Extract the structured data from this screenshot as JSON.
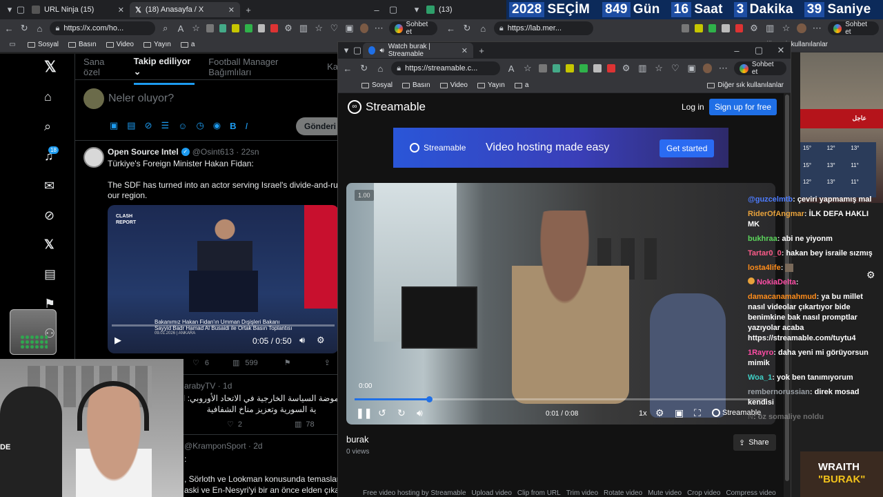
{
  "left_browser": {
    "tabs": [
      {
        "label": "URL Ninja (15)",
        "active": false
      },
      {
        "label": "(18) Anasayfa / X",
        "active": true
      }
    ],
    "url": "https://x.com/ho...",
    "copilot_label": "Sohbet et",
    "bookmarks": [
      "Sosyal",
      "Basın",
      "Video",
      "Yayın",
      "a"
    ]
  },
  "right_browser": {
    "tab_partial": "(13)",
    "url": "https://lab.mer...",
    "copilot_label": "Sohbet et",
    "other_bookmarks": "Diğer sık kullanılanlar"
  },
  "countdown": {
    "year": "2028",
    "label": "SEÇİM",
    "days": "849",
    "days_unit": "Gün",
    "hours": "16",
    "hours_unit": "Saat",
    "minutes": "3",
    "minutes_unit": "Dakika",
    "seconds": "39",
    "seconds_unit": "Saniye"
  },
  "twitter": {
    "tabs": [
      "Sana özel",
      "Takip ediliyor",
      "Football Manager Bağımlıları",
      "Ka"
    ],
    "active_tab": "Takip ediliyor",
    "notif_count": "18",
    "compose_placeholder": "Neler oluyor?",
    "post_button": "Gönderi y",
    "tweet1": {
      "name": "Open Source Intel",
      "handle": "@Osint613 · 22sn",
      "line1": "Türkiye's Foreign Minister Hakan Fidan:",
      "line2": "The SDF has turned into an actor serving Israel's divide-and-rule p",
      "line3": "our region.",
      "video_caption1": "Bakanımız Hakan Fidan'ın Umman Dışişleri Bakanı",
      "video_caption2": "Sayyid Badr Hamad Al Busaidi ile Ortak Basın Toplantısı",
      "video_date": "09.01.2026 | ANKARA",
      "video_time": "0:05 / 0:50",
      "watermark": "CLASH REPORT",
      "likes": "6",
      "views": "599"
    },
    "tweet2": {
      "handle": "arabyTV · 1d",
      "line1": "موضة السياسة الخارجية في الاتحاد الأوروبي: الاتحا",
      "line2": "ية السورية وتعزيز مناخ الشفافية",
      "replies": "2",
      "views": "78"
    },
    "tweet3": {
      "handle": "@KramponSport · 2d",
      "line1": ":",
      "line2": ", Sörloth ve Lookman konusunda temaslarım",
      "line3": "aski ve En-Nesyri'yi bir an önce elden çıkarm"
    }
  },
  "streamable_window": {
    "tab_title": "Watch burak | Streamable",
    "url": "https://streamable.c...",
    "copilot_label": "Sohbet et",
    "bookmarks": [
      "Sosyal",
      "Basın",
      "Video",
      "Yayın",
      "a"
    ],
    "other_bookmarks": "Diğer sık kullanılanlar",
    "logo": "Streamable",
    "login": "Log in",
    "signup": "Sign up for free",
    "banner_logo": "Streamable",
    "banner_text": "Video hosting made easy",
    "banner_button": "Get started",
    "speed_badge": "1.00",
    "hover_time": "0:00",
    "time": "0:01 / 0:08",
    "playback_rate": "1x",
    "player_brand": "Streamable",
    "progress": 0.18,
    "video_title": "burak",
    "views": "0 views",
    "share": "Share",
    "footer": [
      "Free video hosting by Streamable",
      "Upload video",
      "Clip from URL",
      "Trim video",
      "Rotate video",
      "Mute video",
      "Crop video",
      "Compress video"
    ]
  },
  "chat": [
    {
      "user": "@guzcelmtb",
      "msg": "çeviri yapmamış mal",
      "color": "#4d7cff"
    },
    {
      "user": "RiderOfAngmar",
      "msg": "İLK DEFA HAKLI MK",
      "color": "#e8a23b"
    },
    {
      "user": "bukhraa",
      "msg": "abi ne yiyonm",
      "color": "#5bd65b"
    },
    {
      "user": "Tartar0_0",
      "msg": "hakan bey israile sızmış",
      "color": "#ff5c8a"
    },
    {
      "user": "losta4life",
      "msg": "",
      "color": "#ff8c1a"
    },
    {
      "user": "NokiaDelta",
      "msg": "",
      "color": "#ff4da6"
    },
    {
      "user": "damacanamahmud",
      "msg": "ya bu millet nasıl videolar çıkartıyor bide benimkine bak nasıl promptlar yazıyolar acaba https://streamable.com/tuytu4",
      "color": "#ff8c1a"
    },
    {
      "user": "1Rayro",
      "msg": "daha yeni mi görüyorsun mimik",
      "color": "#ff4da6"
    },
    {
      "user": "Woa_1",
      "msg": "yok ben tanımıyorum",
      "color": "#3fd1c7"
    },
    {
      "user": "rembernorussian",
      "msg": "direk mosad kendisi",
      "color": "#9aa0a6"
    },
    {
      "user": "N",
      "msg": "öz somaliye noldu",
      "color": "#777777"
    }
  ],
  "news": {
    "breaking": "عاجل",
    "weather_temps": [
      "15°",
      "12°",
      "13°",
      "15°",
      "13°",
      "11°",
      "12°",
      "13°",
      "11°"
    ]
  },
  "streamer_badge": {
    "line1": "WRAITH",
    "line2": "\"BURAK\""
  }
}
